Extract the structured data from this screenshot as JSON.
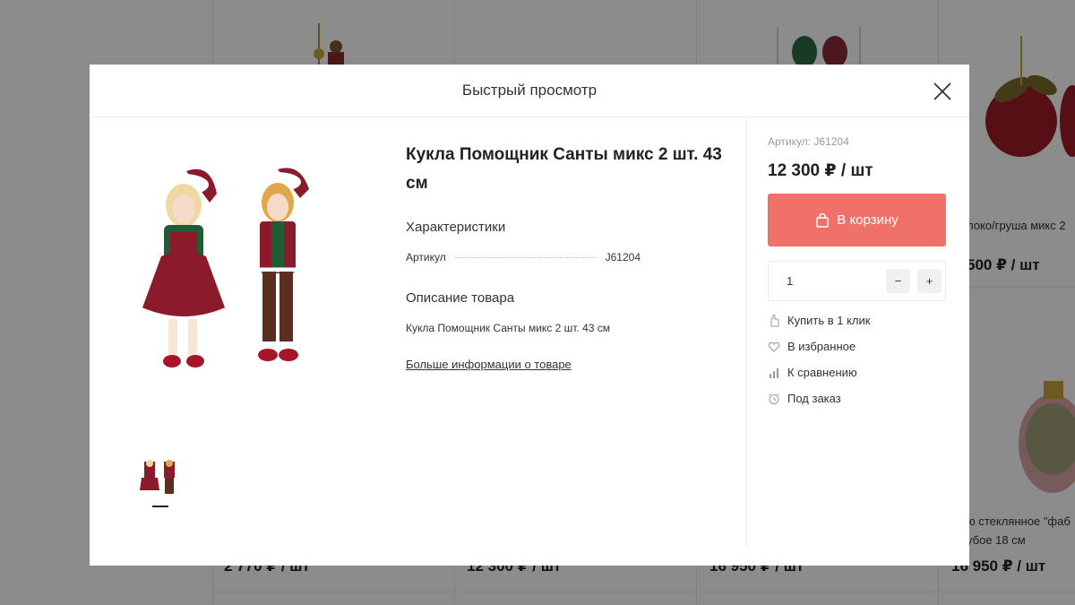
{
  "background": {
    "prices_bottom": [
      "2 770 ₽ / шт",
      "12 300 ₽ / шт",
      "16 950 ₽ / шт",
      "16 950 ₽ / шт"
    ],
    "right_product_1": {
      "name": "локо/груша микс 2",
      "price": "500 ₽ / шт"
    },
    "right_product_2": {
      "name_line1": "ю стеклянное \"фаб",
      "name_line2": "убое 18 см"
    }
  },
  "modal": {
    "title": "Быстрый просмотр",
    "product": {
      "name": "Кукла Помощник Санты микс 2 шт. 43 см",
      "characteristics_title": "Характеристики",
      "specs": [
        {
          "label": "Артикул",
          "value": "J61204"
        }
      ],
      "description_title": "Описание товара",
      "description": "Кукла Помощник Санты микс 2 шт. 43 см",
      "more_link": "Больше информации о товаре"
    },
    "buy": {
      "sku": "Артикул: J61204",
      "price": "12 300 ₽ / шт",
      "cart_label": "В корзину",
      "quantity": "1",
      "minus": "−",
      "plus": "+",
      "actions": {
        "one_click": "Купить в 1 клик",
        "favorites": "В избранное",
        "compare": "К сравнению",
        "order": "Под заказ"
      },
      "colors": {
        "accent": "#f0706a"
      }
    }
  }
}
